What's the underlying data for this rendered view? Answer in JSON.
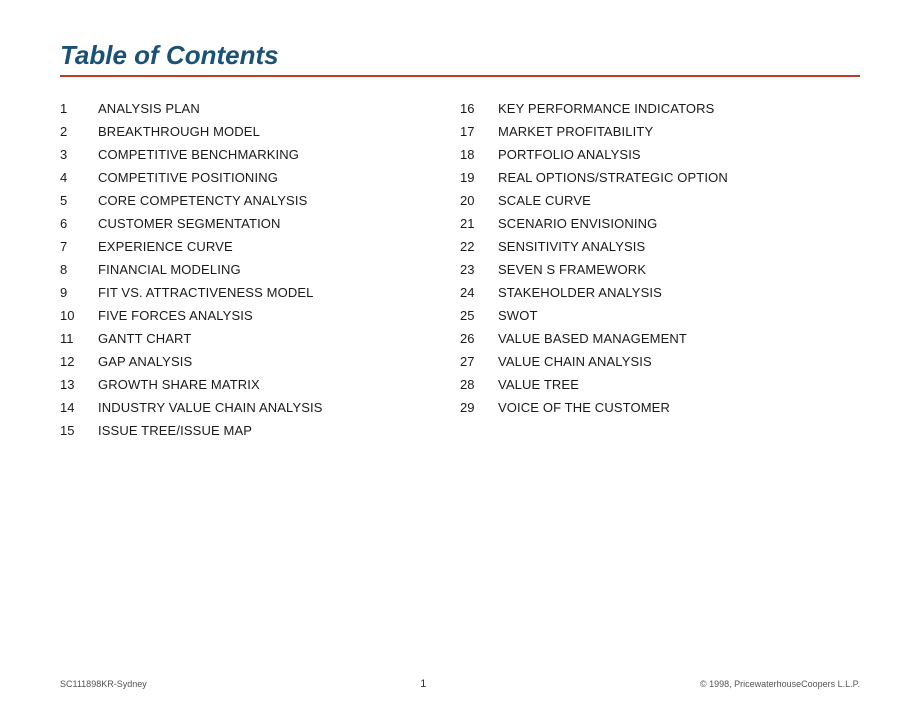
{
  "title": "Table of Contents",
  "divider_color": "#c0392b",
  "left_items": [
    {
      "number": "1",
      "label": "ANALYSIS PLAN"
    },
    {
      "number": "2",
      "label": "BREAKTHROUGH MODEL"
    },
    {
      "number": "3",
      "label": "COMPETITIVE BENCHMARKING"
    },
    {
      "number": "4",
      "label": "COMPETITIVE POSITIONING"
    },
    {
      "number": "5",
      "label": "CORE COMPETENCTY ANALYSIS"
    },
    {
      "number": "6",
      "label": "CUSTOMER SEGMENTATION"
    },
    {
      "number": "7",
      "label": "EXPERIENCE CURVE"
    },
    {
      "number": "8",
      "label": "FINANCIAL MODELING"
    },
    {
      "number": "9",
      "label": "FIT VS. ATTRACTIVENESS MODEL"
    },
    {
      "number": "10",
      "label": "FIVE FORCES ANALYSIS"
    },
    {
      "number": "11",
      "label": "GANTT CHART"
    },
    {
      "number": "12",
      "label": "GAP ANALYSIS"
    },
    {
      "number": "13",
      "label": "GROWTH SHARE MATRIX"
    },
    {
      "number": "14",
      "label": "INDUSTRY VALUE CHAIN ANALYSIS"
    },
    {
      "number": "15",
      "label": "ISSUE TREE/ISSUE MAP"
    }
  ],
  "right_items": [
    {
      "number": "16",
      "label": "KEY PERFORMANCE INDICATORS"
    },
    {
      "number": "17",
      "label": "MARKET PROFITABILITY"
    },
    {
      "number": "18",
      "label": "PORTFOLIO ANALYSIS"
    },
    {
      "number": "19",
      "label": "REAL OPTIONS/STRATEGIC OPTION"
    },
    {
      "number": "20",
      "label": "SCALE CURVE"
    },
    {
      "number": "21",
      "label": "SCENARIO ENVISIONING"
    },
    {
      "number": "22",
      "label": "SENSITIVITY ANALYSIS"
    },
    {
      "number": "23",
      "label": "SEVEN S FRAMEWORK"
    },
    {
      "number": "24",
      "label": "STAKEHOLDER ANALYSIS"
    },
    {
      "number": "25",
      "label": "SWOT"
    },
    {
      "number": "26",
      "label": "VALUE BASED MANAGEMENT"
    },
    {
      "number": "27",
      "label": "VALUE CHAIN ANALYSIS"
    },
    {
      "number": "28",
      "label": "VALUE TREE"
    },
    {
      "number": "29",
      "label": "VOICE OF THE CUSTOMER"
    }
  ],
  "footer": {
    "left": "SC111898KR-Sydney",
    "center": "1",
    "right": "© 1998, PricewaterhouseCoopers L.L.P."
  }
}
